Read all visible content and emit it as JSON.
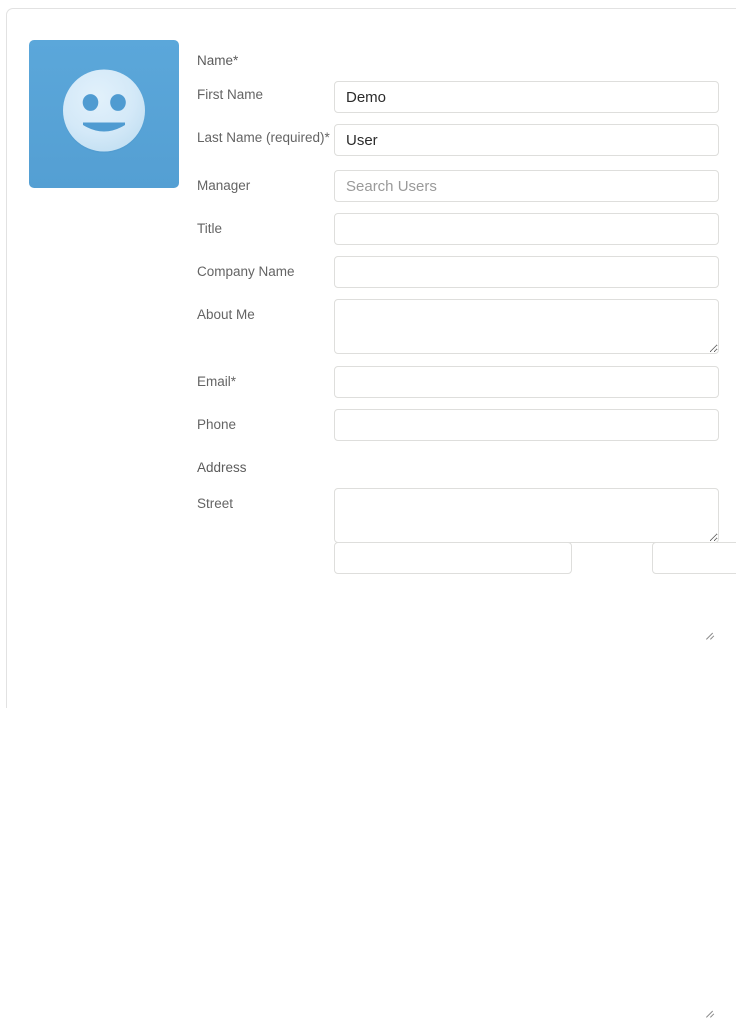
{
  "avatar": {
    "name": "user-avatar",
    "alt": "Default user avatar — smiley face",
    "background_color": "#59a4d8",
    "face_color": "#d3e9f8",
    "feature_color": "#4f9bd1"
  },
  "form": {
    "sections": [
      {
        "key": "name_section",
        "label": "Name*"
      },
      {
        "key": "address_section",
        "label": "Address"
      }
    ],
    "fields": [
      {
        "key": "first_name",
        "label": "First Name",
        "type": "text",
        "value": "Demo",
        "placeholder": ""
      },
      {
        "key": "last_name",
        "label": "Last Name (required)*",
        "type": "text",
        "value": "User",
        "placeholder": ""
      },
      {
        "key": "manager",
        "label": "Manager",
        "type": "text",
        "value": "",
        "placeholder": "Search Users"
      },
      {
        "key": "title",
        "label": "Title",
        "type": "text",
        "value": "",
        "placeholder": ""
      },
      {
        "key": "company_name",
        "label": "Company Name",
        "type": "text",
        "value": "",
        "placeholder": ""
      },
      {
        "key": "about_me",
        "label": "About Me",
        "type": "textarea",
        "value": "",
        "placeholder": ""
      },
      {
        "key": "email",
        "label": "Email*",
        "type": "text",
        "value": "",
        "placeholder": ""
      },
      {
        "key": "phone",
        "label": "Phone",
        "type": "text",
        "value": "",
        "placeholder": ""
      },
      {
        "key": "street",
        "label": "Street",
        "type": "textarea",
        "value": "",
        "placeholder": ""
      }
    ]
  }
}
